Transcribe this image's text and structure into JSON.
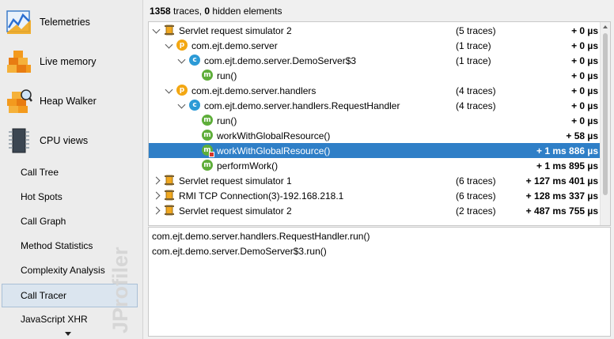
{
  "sidebar": {
    "big_items": [
      {
        "label": "Telemetries",
        "icon": "telemetries-icon"
      },
      {
        "label": "Live memory",
        "icon": "live-memory-icon"
      },
      {
        "label": "Heap Walker",
        "icon": "heap-walker-icon"
      },
      {
        "label": "CPU views",
        "icon": "cpu-views-icon"
      }
    ],
    "sub_items": [
      {
        "label": "Call Tree"
      },
      {
        "label": "Hot Spots"
      },
      {
        "label": "Call Graph"
      },
      {
        "label": "Method Statistics"
      },
      {
        "label": "Complexity Analysis"
      },
      {
        "label": "Call Tracer",
        "selected": true
      },
      {
        "label": "JavaScript XHR"
      }
    ],
    "watermark": "JProfiler"
  },
  "summary": {
    "trace_count": "1358",
    "trace_text": " traces, ",
    "hidden_count": "0",
    "hidden_text": " hidden elements"
  },
  "tree": {
    "rows": [
      {
        "indent": 0,
        "expander": "down",
        "icon": "thread-icon",
        "label": "Servlet request simulator 2",
        "count": "(5 traces)",
        "time": "+ 0 µs"
      },
      {
        "indent": 1,
        "expander": "down",
        "icon": "package-icon",
        "label": "com.ejt.demo.server",
        "count": "(1 trace)",
        "time": "+ 0 µs"
      },
      {
        "indent": 2,
        "expander": "down",
        "icon": "class-icon",
        "label": "com.ejt.demo.server.DemoServer$3",
        "count": "(1 trace)",
        "time": "+ 0 µs"
      },
      {
        "indent": 3,
        "expander": "none",
        "icon": "method-icon",
        "label": "run()",
        "count": "",
        "time": "+ 0 µs"
      },
      {
        "indent": 1,
        "expander": "down",
        "icon": "package-icon",
        "label": "com.ejt.demo.server.handlers",
        "count": "(4 traces)",
        "time": "+ 0 µs"
      },
      {
        "indent": 2,
        "expander": "down",
        "icon": "class-icon",
        "label": "com.ejt.demo.server.handlers.RequestHandler",
        "count": "(4 traces)",
        "time": "+ 0 µs"
      },
      {
        "indent": 3,
        "expander": "none",
        "icon": "method-icon",
        "label": "run()",
        "count": "",
        "time": "+ 0 µs"
      },
      {
        "indent": 3,
        "expander": "none",
        "icon": "method-icon",
        "label": "workWithGlobalResource()",
        "count": "",
        "time": "+ 58 µs"
      },
      {
        "indent": 3,
        "expander": "none",
        "icon": "method-blocked-icon",
        "label": "workWithGlobalResource()",
        "count": "",
        "time": "+ 1 ms 886 µs",
        "selected": true
      },
      {
        "indent": 3,
        "expander": "none",
        "icon": "method-icon",
        "label": "performWork()",
        "count": "",
        "time": "+ 1 ms 895 µs"
      },
      {
        "indent": 0,
        "expander": "right",
        "icon": "thread-icon",
        "label": "Servlet request simulator 1",
        "count": "(6 traces)",
        "time": "+ 127 ms 401 µs"
      },
      {
        "indent": 0,
        "expander": "right",
        "icon": "thread-icon",
        "label": "RMI TCP Connection(3)-192.168.218.1",
        "count": "(6 traces)",
        "time": "+ 128 ms 337 µs"
      },
      {
        "indent": 0,
        "expander": "right",
        "icon": "thread-icon",
        "label": "Servlet request simulator 2",
        "count": "(2 traces)",
        "time": "+ 487 ms 755 µs"
      }
    ]
  },
  "stack": {
    "lines": [
      "com.ejt.demo.server.handlers.RequestHandler.run()",
      "com.ejt.demo.server.DemoServer$3.run()"
    ]
  },
  "colors": {
    "selection": "#2f7fc7",
    "package": "#f3a712",
    "class": "#2c9ad6",
    "method": "#5eae3a"
  }
}
